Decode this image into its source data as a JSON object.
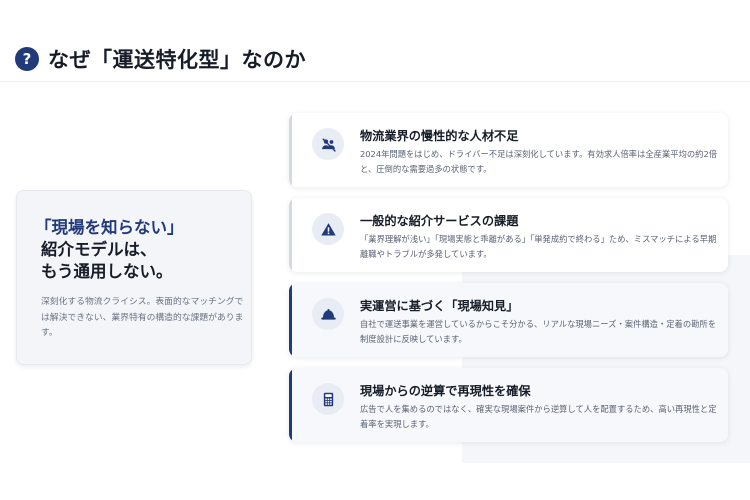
{
  "header": {
    "icon_glyph": "?",
    "title": "なぜ「運送特化型」なのか"
  },
  "left_card": {
    "headline_accent": "「現場を知らない」",
    "headline_line2": "紹介モデルは、",
    "headline_line3": "もう通用しない。",
    "description": "深刻化する物流クライシス。表面的なマッチングでは解決できない、業界特有の構造的な課題があります。"
  },
  "cards": [
    {
      "icon": "users-slash-icon",
      "title": "物流業界の慢性的な人材不足",
      "description": "2024年問題をはじめ、ドライバー不足は深刻化しています。有効求人倍率は全産業平均の約2倍と、圧倒的な需要過多の状態です。"
    },
    {
      "icon": "warning-triangle-icon",
      "title": "一般的な紹介サービスの課題",
      "description": "「業界理解が浅い」「現場実態と乖離がある」「単発成約で終わる」ため、ミスマッチによる早期離職やトラブルが多発しています。"
    },
    {
      "icon": "hard-hat-icon",
      "title": "実運営に基づく「現場知見」",
      "description": "自社で運送事業を運営しているからこそ分かる、リアルな現場ニーズ・案件構造・定着の勘所を制度設計に反映しています。"
    },
    {
      "icon": "calculator-icon",
      "title": "現場からの逆算で再現性を確保",
      "description": "広告で人を集めるのではなく、確実な現場案件から逆算して人を配置するため、高い再現性と定着率を実現します。"
    }
  ],
  "colors": {
    "accent": "#213a7a",
    "icon_bg": "#e8ecf4",
    "muted_text": "#6b7385"
  }
}
